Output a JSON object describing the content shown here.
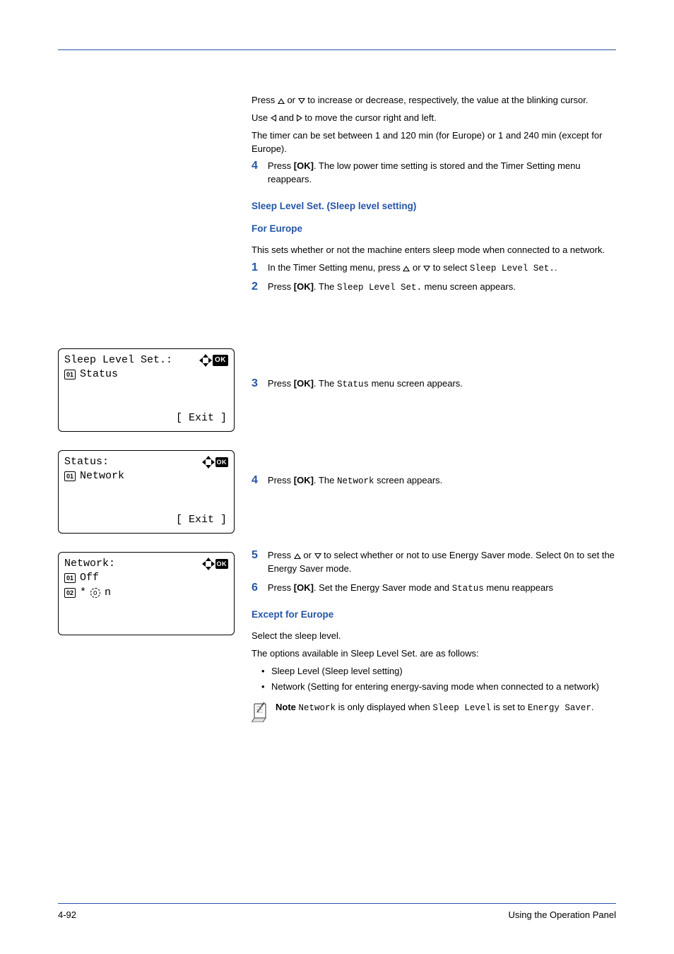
{
  "intro": {
    "p1a": "Press ",
    "p1b": " or ",
    "p1c": " to increase or decrease, respectively, the value at the blinking cursor.",
    "p2a": "Use ",
    "p2b": " and ",
    "p2c": " to move the cursor right and left.",
    "p3": "The timer can be set between 1 and 120 min (for Europe) or 1 and 240 min (except for Europe)."
  },
  "step4top": {
    "num": "4",
    "a": "Press ",
    "ok": "[OK]",
    "b": ". The low power time setting is stored and the Timer Setting menu reappears."
  },
  "heading1": "Sleep Level Set. (Sleep level setting)",
  "heading2": "For Europe",
  "europe_intro": "This sets whether or not the machine enters sleep mode when connected to a network.",
  "step1": {
    "num": "1",
    "a": "In the Timer Setting menu, press ",
    "b": " or ",
    "c": " to select ",
    "mono": "Sleep Level Set.",
    "d": "."
  },
  "step2": {
    "num": "2",
    "a": "Press ",
    "ok": "[OK]",
    "b": ". The ",
    "mono": "Sleep Level Set.",
    "c": " menu screen appears."
  },
  "step3": {
    "num": "3",
    "a": "Press ",
    "ok": "[OK]",
    "b": ". The ",
    "mono": "Status",
    "c": " menu screen appears."
  },
  "step4": {
    "num": "4",
    "a": "Press ",
    "ok": "[OK]",
    "b": ". The ",
    "mono": "Network",
    "c": " screen appears."
  },
  "step5": {
    "num": "5",
    "a": "Press ",
    "b": " or ",
    "c": " to select whether or not to use Energy Saver mode. Select ",
    "mono": "On",
    "d": " to set the Energy Saver mode."
  },
  "step6": {
    "num": "6",
    "a": "Press ",
    "ok": "[OK]",
    "b": ". Set the Energy Saver mode and ",
    "mono": "Status",
    "c": " menu reappears"
  },
  "heading3": "Except for Europe",
  "except": {
    "p1": "Select the sleep level.",
    "p2": "The options available in Sleep Level Set. are as follows:",
    "li1": "Sleep Level (Sleep level setting)",
    "li2": "Network (Setting for entering energy-saving mode when connected to a network)"
  },
  "note": {
    "label": "Note",
    "a": " ",
    "mono1": "Network",
    "b": " is only displayed when ",
    "mono2": "Sleep Level",
    "c": " is set to ",
    "mono3": "Energy Saver",
    "d": "."
  },
  "lcd1": {
    "title": "Sleep Level Set.:",
    "badge": "01",
    "item": "Status",
    "exit": "[  Exit  ]"
  },
  "lcd2": {
    "title": "Status:",
    "badge": "01",
    "item": "Network",
    "exit": "[  Exit  ]"
  },
  "lcd3": {
    "title": "Network:",
    "badge1": "01",
    "item1": "Off",
    "badge2": "02",
    "item2": "On"
  },
  "footer": {
    "left": "4-92",
    "right": "Using the Operation Panel"
  }
}
